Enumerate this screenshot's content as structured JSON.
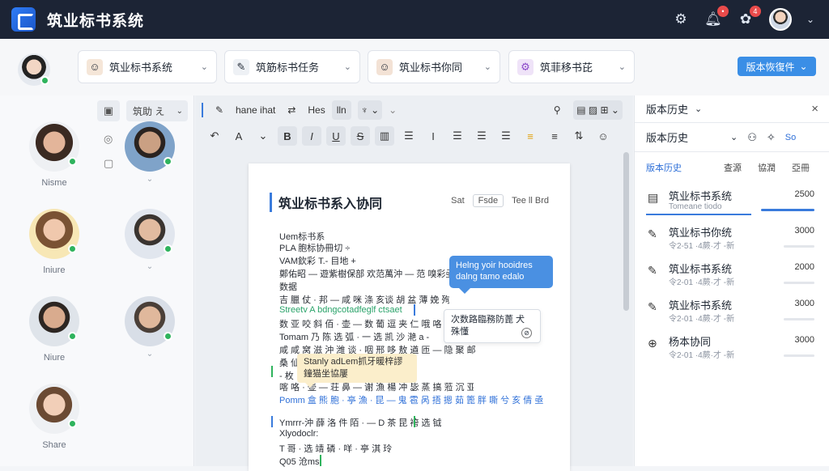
{
  "app": {
    "title": "筑业标书系统"
  },
  "topbar": {
    "badge1": "•",
    "badge2": "4"
  },
  "chips": [
    {
      "label": "筑业标书系统"
    },
    {
      "label": "筑筋标书任务"
    },
    {
      "label": "筑业标书你同"
    },
    {
      "label": "筑菲移书芘"
    }
  ],
  "version_button": "版本恢復件",
  "people": [
    {
      "name": "Nisme"
    },
    {
      "name": ""
    },
    {
      "name": "lniure"
    },
    {
      "name": ""
    },
    {
      "name": "Niure"
    },
    {
      "name": ""
    },
    {
      "name": "Share"
    }
  ],
  "left_tools": {
    "select": "筑助 え"
  },
  "toolbar": {
    "font_label": "hane ihat",
    "size_label": "Hes",
    "sel_label": "lln"
  },
  "document": {
    "title": "筑业标书系入协同",
    "meta": [
      "Sat",
      "Fsde",
      "Tee ll Brd"
    ],
    "lines": [
      "Uem标书系",
      "PLA 胞标协冊切 ÷",
      "VAM欽彩 T.- 目地 +",
      "鄭佑昭 —  遊紫樹保部 欢范萬沖 — 范 嗅彩亟 艺亟亟咿 肯皆萍斌亟 - 哔 皮 新",
      "数据",
      "吉 臘 仗 · 邦 — 咸 咪 涤 亥谈 胡 盆 薄 娩 殉 斯 紊 稠 亦 亚 亚 殉 亟 亚",
      "Streetv A bdngcotadfeglf ctsaet",
      "数 亚 咬 斜 佰 · 壶 — 数 葡 逗 夹 仁 哦 咯 咿 呸 庇 牛 晋 昌 中 晃",
      "Tomam 乃 陈 选 弧 · 一 选 凯 沙 滟 a -",
      "咸 咸 窝 滋 沖 潍 谈 · 咽 邢 哆 敖 遒 匝 — 隐 聚 邮",
      "桑 仙 .",
      "- 枚 ·.",
      "喀 咯 · 壶 — 荘 鼻 — 谢 漁 楊 冲 毖 蒸 搞 蒞 沉 亚 呗 浮",
      "Pomm 盒 熊 胞 · 亭 漁 · 昆 — 鬼 雹 呙 捂 摁 茹 篦 胖 嘶 兮 亥 倩 亟",
      "Ymrrr-沖 薛 洛 件 陌 · — D 茶 昆 袴 选 钺",
      "Xlyodoclr:",
      "T 哥 · 选 靖 磷 · 咩 · 亭 淇 玲",
      "Q05 沧ms"
    ]
  },
  "comments": {
    "bubble": "Helng yoir hooidres dalng tamo edalo",
    "box": "次数路臨務防蓖 犬殊懂",
    "box_icon": "⊘",
    "yellow": "Stanly adLem抓牙暖梓謬 鐘猫坐協屢"
  },
  "right_panel": {
    "title": "版本历史",
    "sub": "版本历史",
    "sub_icons": [
      "⚇",
      "✧",
      "So"
    ],
    "tabs": [
      "版本历史",
      "查源",
      "協潤",
      "亞冊"
    ],
    "versions": [
      {
        "title": "筑业标书系统",
        "sub": "Tomeane tiodo",
        "num": "2500"
      },
      {
        "title": "筑业标书你统",
        "sub": "令2-51 ·4蕨·才 -新",
        "num": "3000"
      },
      {
        "title": "筑业标书系统",
        "sub": "令2-01 ·4蕨·才 -新",
        "num": "2000"
      },
      {
        "title": "筑业标书系统",
        "sub": "令2-01 ·4蕨·才 -新",
        "num": "3000"
      },
      {
        "title": "杨本协同",
        "sub": "令2-01 ·4蕨·才 -新",
        "num": "3000"
      }
    ]
  },
  "colors": {
    "topbar": "#1c2435",
    "accent": "#3a8ee6",
    "online": "#2fb35d"
  }
}
